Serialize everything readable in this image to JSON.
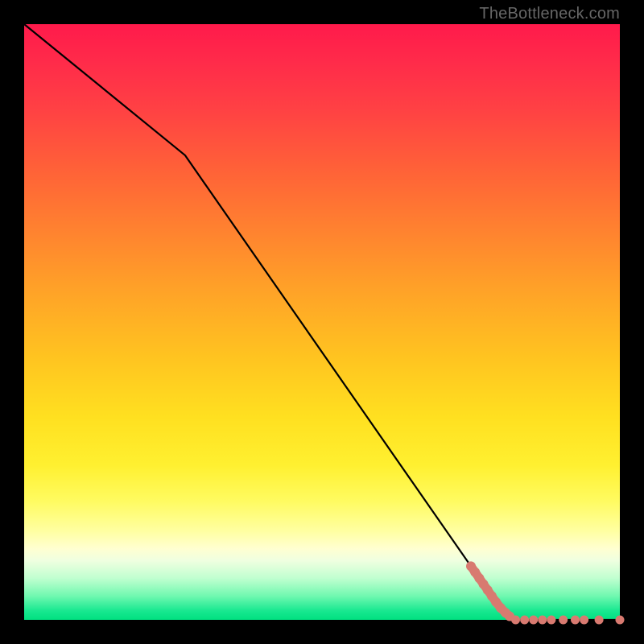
{
  "watermark": "TheBottleneck.com",
  "chart_data": {
    "type": "line",
    "title": "",
    "xlabel": "",
    "ylabel": "",
    "xlim": [
      0,
      100
    ],
    "ylim": [
      0,
      100
    ],
    "gradient": "red-yellow-green vertical",
    "line": {
      "x": [
        0,
        27,
        75,
        82,
        100
      ],
      "y": [
        100,
        78,
        9,
        0,
        0
      ],
      "color": "#000000"
    },
    "series": [
      {
        "name": "markers",
        "color": "#d87a70",
        "points": [
          {
            "x": 75.0,
            "y": 9.0
          },
          {
            "x": 75.7,
            "y": 8.0
          },
          {
            "x": 76.4,
            "y": 7.0
          },
          {
            "x": 77.1,
            "y": 6.0
          },
          {
            "x": 77.8,
            "y": 5.0
          },
          {
            "x": 78.5,
            "y": 4.0
          },
          {
            "x": 79.2,
            "y": 3.0
          },
          {
            "x": 80.0,
            "y": 2.0
          },
          {
            "x": 80.8,
            "y": 1.2
          },
          {
            "x": 81.5,
            "y": 0.6
          },
          {
            "x": 82.5,
            "y": 0.0
          },
          {
            "x": 84.0,
            "y": 0.0
          },
          {
            "x": 85.5,
            "y": 0.0
          },
          {
            "x": 87.0,
            "y": 0.0
          },
          {
            "x": 88.5,
            "y": 0.0
          },
          {
            "x": 90.5,
            "y": 0.0
          },
          {
            "x": 92.5,
            "y": 0.0
          },
          {
            "x": 94.0,
            "y": 0.0
          },
          {
            "x": 96.5,
            "y": 0.0
          },
          {
            "x": 100.0,
            "y": 0.0
          }
        ]
      }
    ]
  },
  "colors": {
    "marker": "#d87a70",
    "line": "#000000"
  }
}
